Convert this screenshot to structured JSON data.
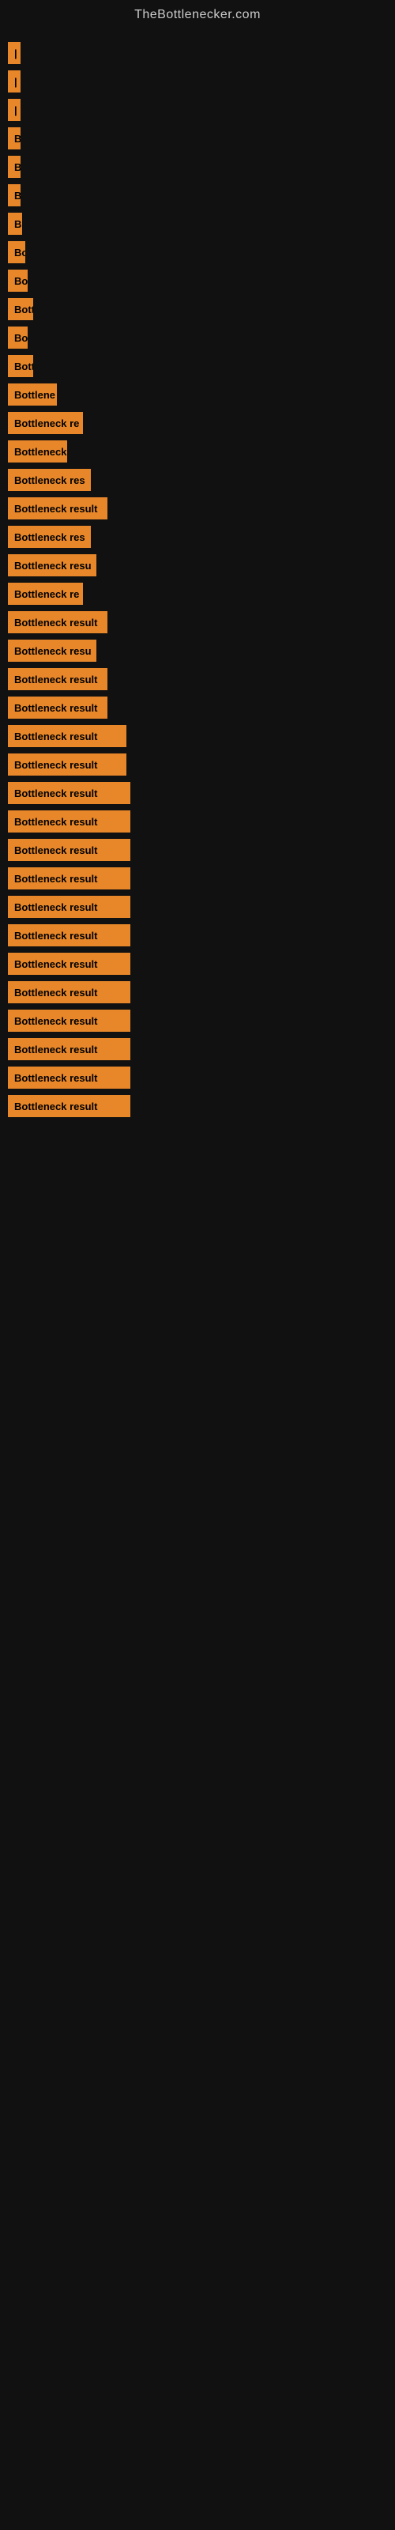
{
  "site": {
    "title": "TheBottlenecker.com"
  },
  "results": [
    {
      "label": "|",
      "width": 4
    },
    {
      "label": "|",
      "width": 4
    },
    {
      "label": "|",
      "width": 4
    },
    {
      "label": "B",
      "width": 12
    },
    {
      "label": "B",
      "width": 12
    },
    {
      "label": "B",
      "width": 12
    },
    {
      "label": "B",
      "width": 18
    },
    {
      "label": "Bo",
      "width": 22
    },
    {
      "label": "Bo",
      "width": 25
    },
    {
      "label": "Bott",
      "width": 32
    },
    {
      "label": "Bo",
      "width": 25
    },
    {
      "label": "Bott",
      "width": 32
    },
    {
      "label": "Bottlene",
      "width": 62
    },
    {
      "label": "Bottleneck re",
      "width": 95
    },
    {
      "label": "Bottleneck",
      "width": 75
    },
    {
      "label": "Bottleneck res",
      "width": 105
    },
    {
      "label": "Bottleneck result",
      "width": 126
    },
    {
      "label": "Bottleneck res",
      "width": 105
    },
    {
      "label": "Bottleneck resu",
      "width": 112
    },
    {
      "label": "Bottleneck re",
      "width": 95
    },
    {
      "label": "Bottleneck result",
      "width": 126
    },
    {
      "label": "Bottleneck resu",
      "width": 112
    },
    {
      "label": "Bottleneck result",
      "width": 126
    },
    {
      "label": "Bottleneck result",
      "width": 126
    },
    {
      "label": "Bottleneck result",
      "width": 150
    },
    {
      "label": "Bottleneck result",
      "width": 150
    },
    {
      "label": "Bottleneck result",
      "width": 155
    },
    {
      "label": "Bottleneck result",
      "width": 155
    },
    {
      "label": "Bottleneck result",
      "width": 155
    },
    {
      "label": "Bottleneck result",
      "width": 155
    },
    {
      "label": "Bottleneck result",
      "width": 155
    },
    {
      "label": "Bottleneck result",
      "width": 155
    },
    {
      "label": "Bottleneck result",
      "width": 155
    },
    {
      "label": "Bottleneck result",
      "width": 155
    },
    {
      "label": "Bottleneck result",
      "width": 155
    },
    {
      "label": "Bottleneck result",
      "width": 155
    },
    {
      "label": "Bottleneck result",
      "width": 155
    },
    {
      "label": "Bottleneck result",
      "width": 155
    }
  ]
}
